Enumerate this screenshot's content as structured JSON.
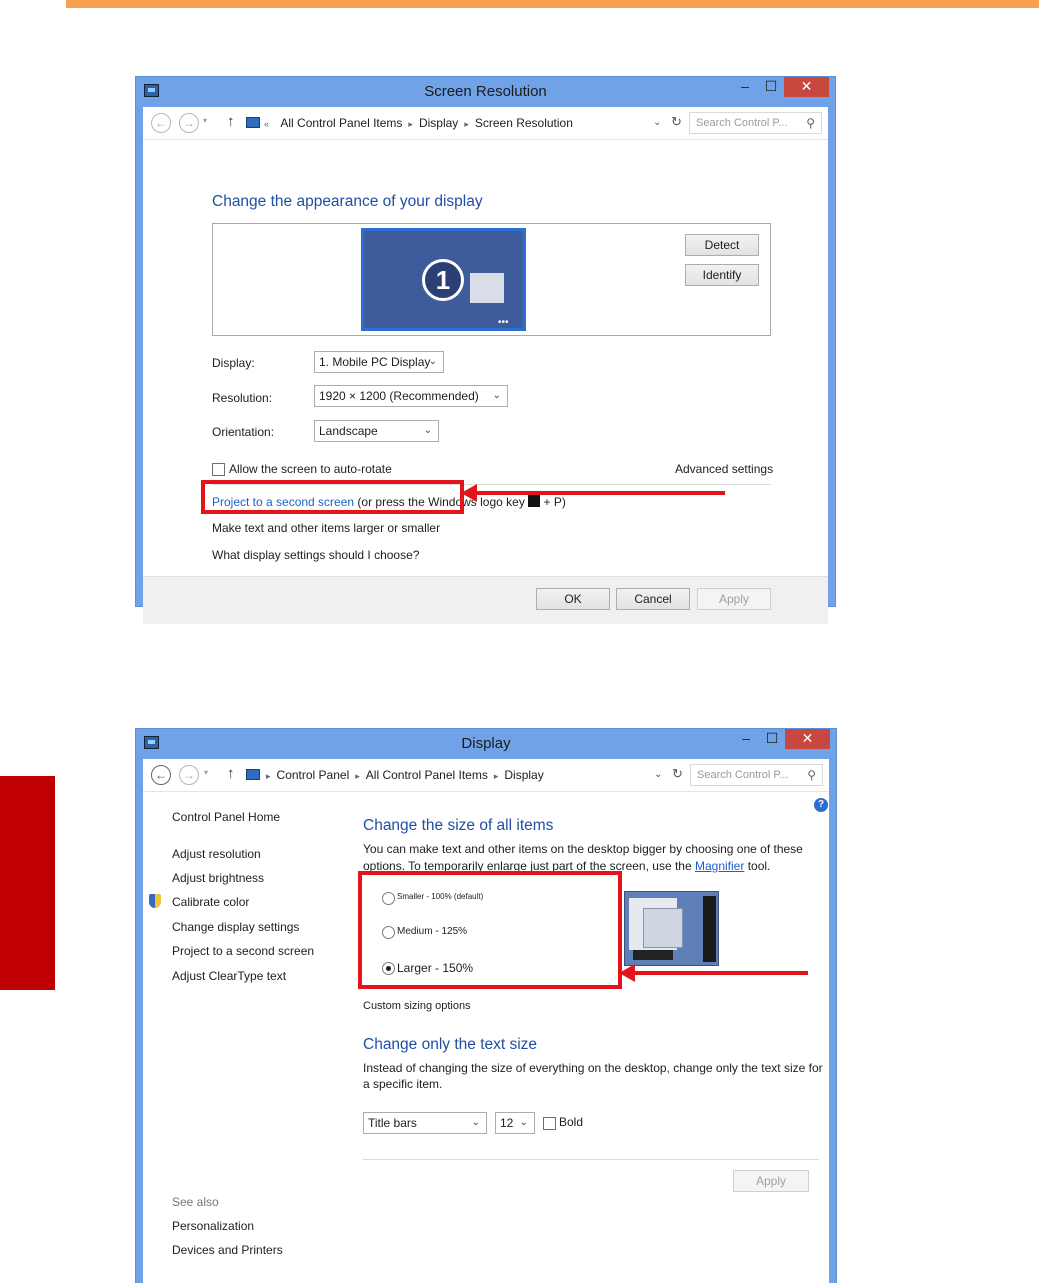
{
  "colors": {
    "accent_bar": "#f7a14f",
    "side_tab": "#c00000",
    "annotation_red": "#e4141b",
    "link_blue": "#1a62c9",
    "heading_blue": "#1f4fa3"
  },
  "win1": {
    "title": "Screen Resolution",
    "minimize": "–",
    "maximize": "☐",
    "close": "✕",
    "breadcrumb": [
      "All Control Panel Items",
      "Display",
      "Screen Resolution"
    ],
    "search_placeholder": "Search Control P...",
    "heading": "Change the appearance of your display",
    "monitor_number": "1",
    "detect_button": "Detect",
    "identify_button": "Identify",
    "display_label": "Display:",
    "display_value": "1. Mobile PC Display",
    "resolution_label": "Resolution:",
    "resolution_value": "1920 × 1200 (Recommended)",
    "orientation_label": "Orientation:",
    "orientation_value": "Landscape",
    "autorotate_label": "Allow the screen to auto-rotate",
    "advanced_link": "Advanced settings",
    "project_link": "Project to a second screen",
    "project_suffix_a": "(or press the Windows logo key",
    "project_suffix_b": "+ P)",
    "make_text_link": "Make text and other items larger or smaller",
    "what_settings_link": "What display settings should I choose?",
    "ok_button": "OK",
    "cancel_button": "Cancel",
    "apply_button": "Apply"
  },
  "win2": {
    "title": "Display",
    "minimize": "–",
    "maximize": "☐",
    "close": "✕",
    "breadcrumb": [
      "Control Panel",
      "All Control Panel Items",
      "Display"
    ],
    "search_placeholder": "Search Control P...",
    "help_icon": "?",
    "sidebar": {
      "home": "Control Panel Home",
      "items": [
        "Adjust resolution",
        "Adjust brightness",
        "Calibrate color",
        "Change display settings",
        "Project to a second screen",
        "Adjust ClearType text"
      ],
      "see_also": "See also",
      "see_also_items": [
        "Personalization",
        "Devices and Printers"
      ]
    },
    "heading1": "Change the size of all items",
    "desc1_a": "You can make text and other items on the desktop bigger by choosing one of these",
    "desc1_b": "options. To temporarily enlarge just part of the screen, use the",
    "magnifier_link": "Magnifier",
    "desc1_c": "tool.",
    "options": [
      "Smaller - 100% (default)",
      "Medium - 125%",
      "Larger - 150%"
    ],
    "selected_option": "Larger - 150%",
    "custom_link": "Custom sizing options",
    "heading2": "Change only the text size",
    "desc2_a": "Instead of changing the size of everything on the desktop, change only the text size for",
    "desc2_b": "a specific item.",
    "item_select": "Title bars",
    "size_select": "12",
    "bold_label": "Bold",
    "apply_button": "Apply"
  }
}
